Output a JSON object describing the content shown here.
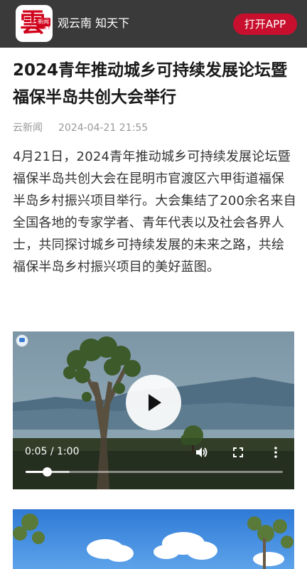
{
  "header": {
    "logo_glyph": "雲",
    "logo_badge": "新闻",
    "logo_sub": "观云南·知天下",
    "app_name": "观云南  知天下",
    "open_app_label": "打开APP"
  },
  "article": {
    "title": "2024青年推动城乡可持续发展论坛暨福保半岛共创大会举行",
    "source": "云新闻",
    "datetime": "2024-04-21 21:55",
    "body": "4月21日，2024青年推动城乡可持续发展论坛暨福保半岛共创大会在昆明市官渡区六甲街道福保半岛乡村振兴项目举行。大会集结了200余名来自全国各地的专家学者、青年代表以及社会各界人士，共同探讨城乡可持续发展的未来之路，共绘福保半岛乡村振兴项目的美好蓝图。"
  },
  "video": {
    "time_display": "0:05 / 1:00",
    "played_fraction": 0.0833,
    "buffered_fraction": 0.17,
    "icons": {
      "play": "play-icon",
      "volume": "volume-icon",
      "fullscreen": "fullscreen-icon",
      "more": "more-vertical-icon"
    }
  },
  "colors": {
    "header_bg": "#3a3a3a",
    "accent": "#c8102e",
    "text": "#333333",
    "meta": "#9a9a9a"
  }
}
